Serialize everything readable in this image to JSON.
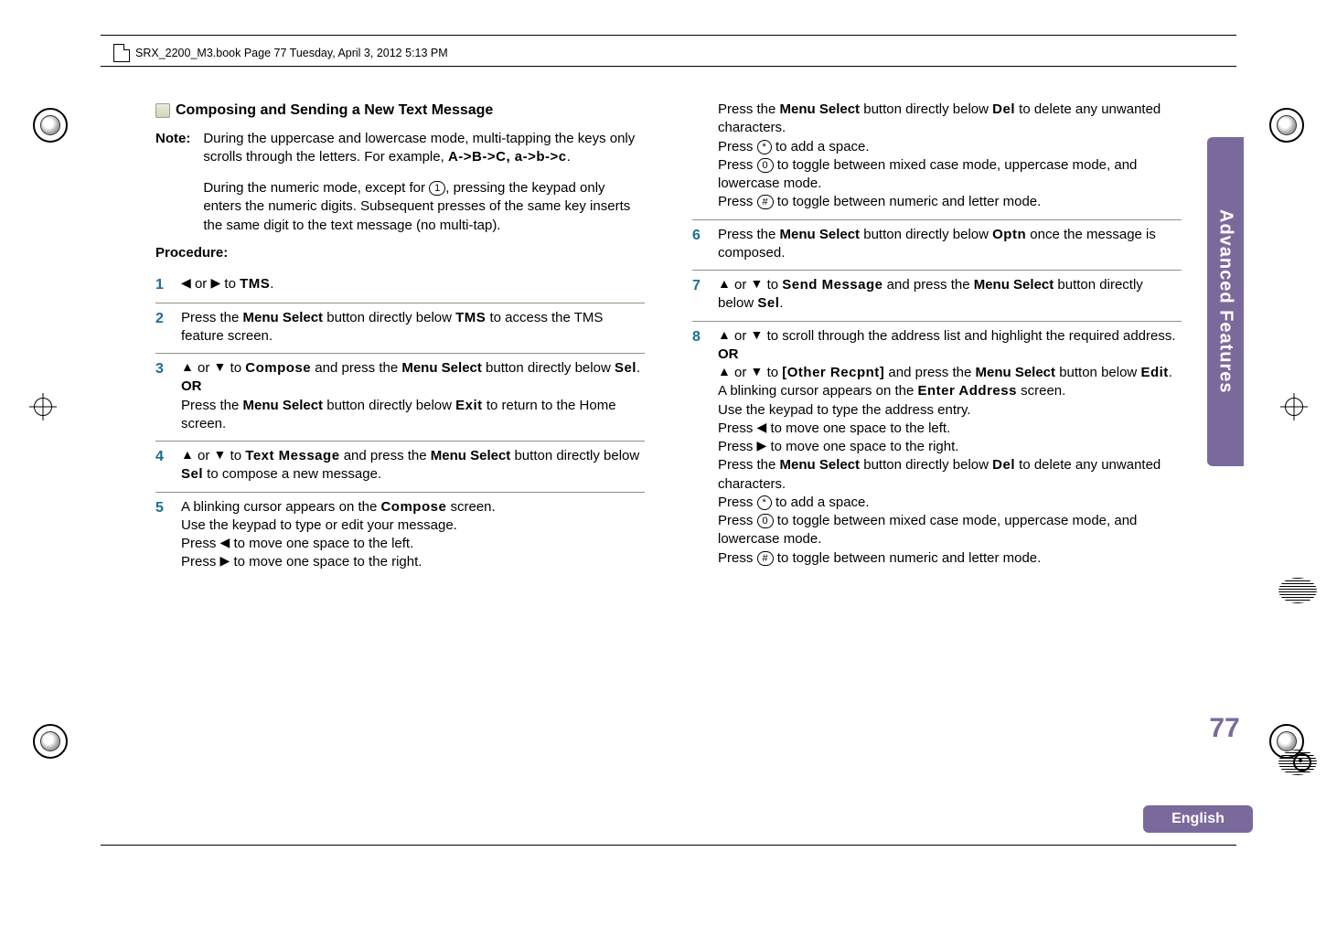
{
  "header": {
    "text": "SRX_2200_M3.book  Page 77  Tuesday, April 3, 2012  5:13 PM"
  },
  "side_tab": "Advanced Features",
  "page_number": "77",
  "language": "English",
  "section_title": "Composing and Sending a New Text Message",
  "note": {
    "label": "Note:",
    "para1_a": "During the uppercase and lowercase mode, multi-tapping the keys only scrolls through the letters. For example, ",
    "para1_seq": "A->B->C, a->b->c",
    "para1_b": ".",
    "para2_a": "During the numeric mode, except for ",
    "para2_key": "1",
    "para2_b": ", pressing the keypad only enters the numeric digits. Subsequent presses of the same key inserts the same digit to the text message (no multi-tap)."
  },
  "procedure_label": "Procedure:",
  "steps_left": [
    {
      "num": "1",
      "html": "<span class='glyph bare'>◀</span> or <span class='glyph bare'>▶</span> to <span class='mono'>TMS</span>."
    },
    {
      "num": "2",
      "html": "Press the <span class='bold'>Menu Select</span> button directly below <span class='mono'>TMS</span> to access the TMS feature screen."
    },
    {
      "num": "3",
      "html": "<span class='glyph bare'>▲</span> or <span class='glyph bare'>▼</span> to <span class='mono'>Compose</span> and press the <span class='bold'>Menu Select</span> button directly below <span class='mono'>Sel</span>.<br><span class='bold'>OR</span><br>Press the <span class='bold'>Menu Select</span> button directly below <span class='mono'>Exit</span> to return to the Home screen."
    },
    {
      "num": "4",
      "html": "<span class='glyph bare'>▲</span> or <span class='glyph bare'>▼</span> to <span class='mono'>Text Message</span> and press the <span class='bold'>Menu Select</span> button directly below <span class='mono'>Sel</span> to compose a new message."
    },
    {
      "num": "5",
      "html": "A blinking cursor appears on the <span class='mono'>Compose</span> screen.<br>Use the keypad to type or edit your message.<br>Press <span class='glyph bare'>◀</span> to move one space to the left.<br>Press <span class='glyph bare'>▶</span> to move one space to the right."
    }
  ],
  "right_intro": {
    "html": "Press the <span class='bold'>Menu Select</span> button directly below <span class='mono'>Del</span> to delete any unwanted characters.<br>Press <span class='glyph'>*</span> to add a space.<br>Press <span class='glyph'>0</span> to toggle between mixed case mode, uppercase mode, and lowercase mode.<br>Press <span class='glyph'>#</span> to toggle between numeric and letter mode."
  },
  "steps_right": [
    {
      "num": "6",
      "html": "Press the <span class='bold'>Menu Select</span> button directly below <span class='mono'>Optn</span> once the message is composed."
    },
    {
      "num": "7",
      "html": "<span class='glyph bare'>▲</span> or <span class='glyph bare'>▼</span> to <span class='mono'>Send Message</span> and press the <span class='bold'>Menu Select</span> button directly below <span class='mono'>Sel</span>."
    },
    {
      "num": "8",
      "html": "<span class='glyph bare'>▲</span> or <span class='glyph bare'>▼</span> to scroll through the address list and highlight the required address.<br><span class='bold'>OR</span><br><span class='glyph bare'>▲</span> or <span class='glyph bare'>▼</span> to <span class='mono'>[Other Recpnt]</span> and press the <span class='bold'>Menu Select</span> button below <span class='mono'>Edit</span>.<br>A blinking cursor appears on the <span class='mono'>Enter Address</span> screen.<br>Use the keypad to type the address entry.<br>Press <span class='glyph bare'>◀</span> to move one space to the left.<br>Press <span class='glyph bare'>▶</span> to move one space to the right.<br>Press the <span class='bold'>Menu Select</span> button directly below <span class='mono'>Del</span> to delete any unwanted characters.<br>Press <span class='glyph'>*</span> to add a space.<br>Press <span class='glyph'>0</span> to toggle between mixed case mode, uppercase mode, and lowercase mode.<br>Press <span class='glyph'>#</span> to toggle between numeric and letter mode."
    }
  ]
}
